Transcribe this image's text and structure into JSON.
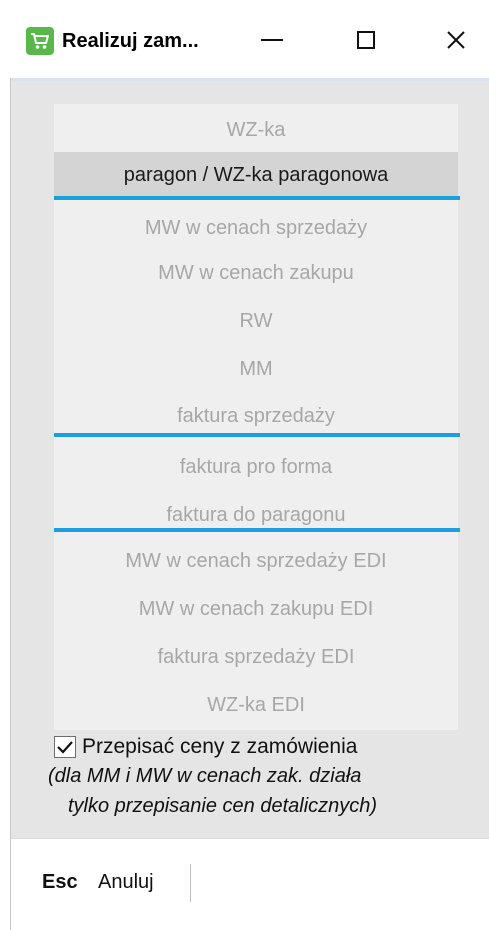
{
  "window": {
    "title": "Realizuj zam...",
    "icon": "shopping-cart-icon",
    "controls": [
      "minimize",
      "maximize",
      "close"
    ]
  },
  "document_types": {
    "selected_index": 1,
    "items": [
      "WZ-ka",
      "paragon / WZ-ka paragonowa",
      "MW w cenach sprzedaży",
      "MW w cenach zakupu",
      "RW",
      "MM",
      "faktura sprzedaży",
      "faktura pro forma",
      "faktura do paragonu",
      "MW w cenach sprzedaży EDI",
      "MW w cenach zakupu EDI",
      "faktura sprzedaży EDI",
      "WZ-ka EDI"
    ]
  },
  "options": {
    "copy_prices_label": "Przepisać ceny z zamówienia",
    "copy_prices_checked": true,
    "note_line1": "(dla MM i MW w cenach zak. działa",
    "note_line2": "tylko przepisanie cen detalicznych)"
  },
  "footer": {
    "shortcut_key": "Esc",
    "cancel_label": "Anuluj"
  },
  "colors": {
    "separator": "#1c9fe0",
    "app_icon": "#58b84a",
    "selected_row": "#d4d4d4"
  }
}
